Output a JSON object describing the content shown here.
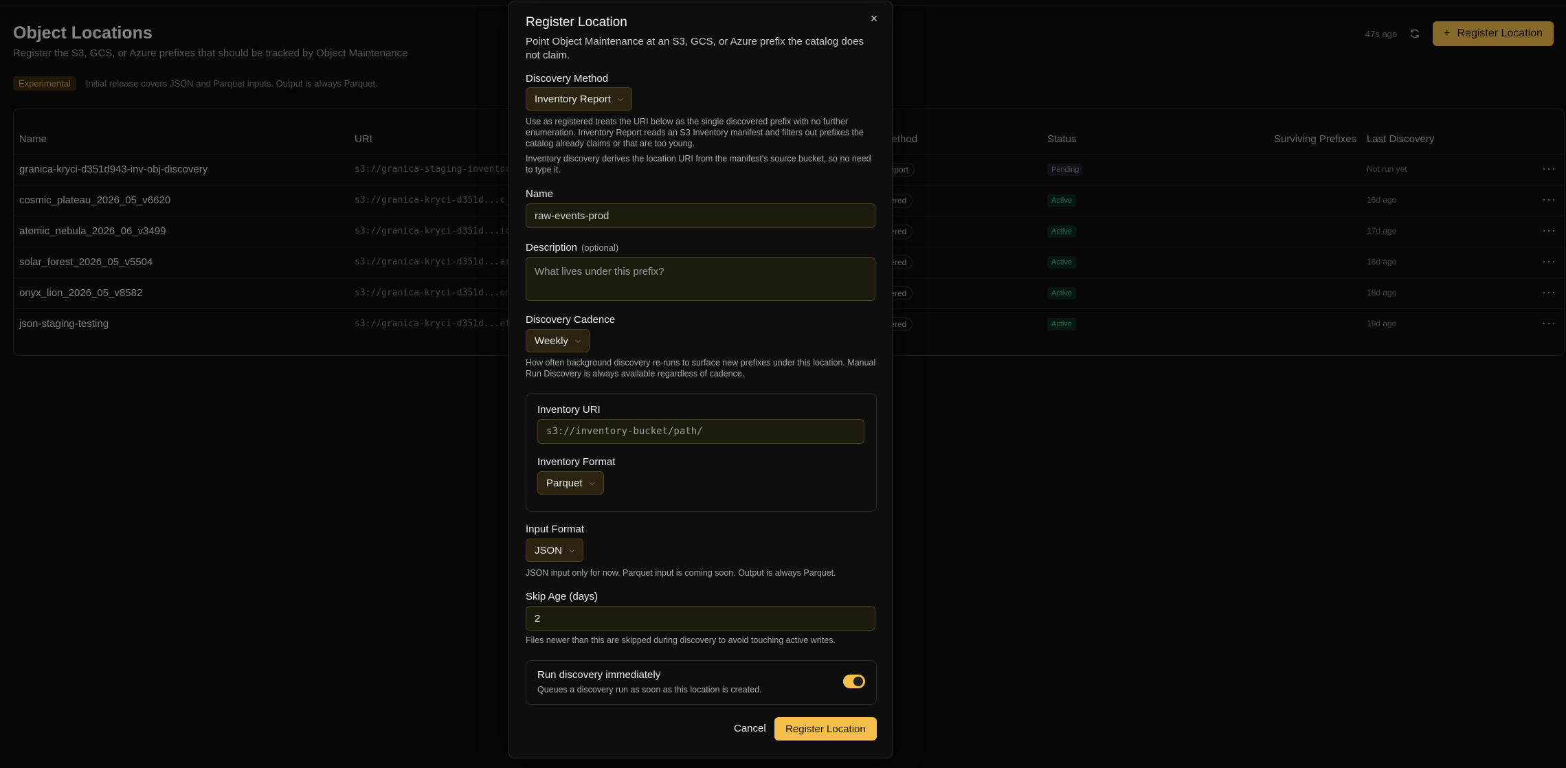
{
  "page": {
    "title": "Object Locations",
    "subtitle": "Register the S3, GCS, or Azure prefixes that should be tracked by Object Maintenance",
    "experimental_badge": "Experimental",
    "experimental_note": "Initial release covers JSON and Parquet inputs. Output is always Parquet.",
    "updated_ago": "47s ago",
    "register_button": "Register Location"
  },
  "table": {
    "columns": {
      "name": "Name",
      "uri": "URI",
      "method": "Method",
      "status": "Status",
      "surviving": "Surviving Prefixes",
      "last": "Last Discovery"
    },
    "rows": [
      {
        "name": "granica-kryci-d351d943-inv-obj-discovery",
        "uri": "s3://granica-staging-inventory/",
        "method": "Report",
        "status": "Pending",
        "last": "Not run yet",
        "more": "···"
      },
      {
        "name": "cosmic_plateau_2026_05_v6620",
        "uri": "s3://granica-kryci-d351d...c_pl",
        "method": "stered",
        "status": "Active",
        "last": "16d ago",
        "more": "···"
      },
      {
        "name": "atomic_nebula_2026_06_v3499",
        "uri": "s3://granica-kryci-d351d...ic_n",
        "method": "stered",
        "status": "Active",
        "last": "17d ago",
        "more": "···"
      },
      {
        "name": "solar_forest_2026_05_v5504",
        "uri": "s3://granica-kryci-d351d...ar_f",
        "method": "stered",
        "status": "Active",
        "last": "18d ago",
        "more": "···"
      },
      {
        "name": "onyx_lion_2026_05_v8582",
        "uri": "s3://granica-kryci-d351d...onyx",
        "method": "stered",
        "status": "Active",
        "last": "18d ago",
        "more": "···"
      },
      {
        "name": "json-staging-testing",
        "uri": "s3://granica-kryci-d351d...et_v",
        "method": "stered",
        "status": "Active",
        "last": "19d ago",
        "more": "···"
      }
    ]
  },
  "modal": {
    "title": "Register Location",
    "close": "×",
    "description": "Point Object Maintenance at an S3, GCS, or Azure prefix the catalog does not claim.",
    "discovery_method_label": "Discovery Method",
    "discovery_method_value": "Inventory Report",
    "discovery_method_help1": "Use as registered treats the URI below as the single discovered prefix with no further enumeration. Inventory Report reads an S3 Inventory manifest and filters out prefixes the catalog already claims or that are too young.",
    "discovery_method_help2": "Inventory discovery derives the location URI from the manifest's source bucket, so no need to type it.",
    "name_label": "Name",
    "name_value": "raw-events-prod",
    "description_label": "Description",
    "description_optional": "(optional)",
    "description_placeholder": "What lives under this prefix?",
    "cadence_label": "Discovery Cadence",
    "cadence_value": "Weekly",
    "cadence_help": "How often background discovery re-runs to surface new prefixes under this location. Manual Run Discovery is always available regardless of cadence.",
    "inventory_uri_label": "Inventory URI",
    "inventory_uri_placeholder": "s3://inventory-bucket/path/",
    "inventory_format_label": "Inventory Format",
    "inventory_format_value": "Parquet",
    "input_format_label": "Input Format",
    "input_format_value": "JSON",
    "input_format_help": "JSON input only for now. Parquet input is coming soon. Output is always Parquet.",
    "skip_age_label": "Skip Age (days)",
    "skip_age_value": "2",
    "skip_age_help": "Files newer than this are skipped during discovery to avoid touching active writes.",
    "run_now_label": "Run discovery immediately",
    "run_now_help": "Queues a discovery run as soon as this location is created.",
    "run_now_on": true,
    "cancel": "Cancel",
    "submit": "Register Location"
  },
  "colors": {
    "accent": "#f5c04a",
    "active_status": "#3ac58a",
    "pending_status": "#8b8ea0",
    "experimental": "#e6a84a"
  }
}
